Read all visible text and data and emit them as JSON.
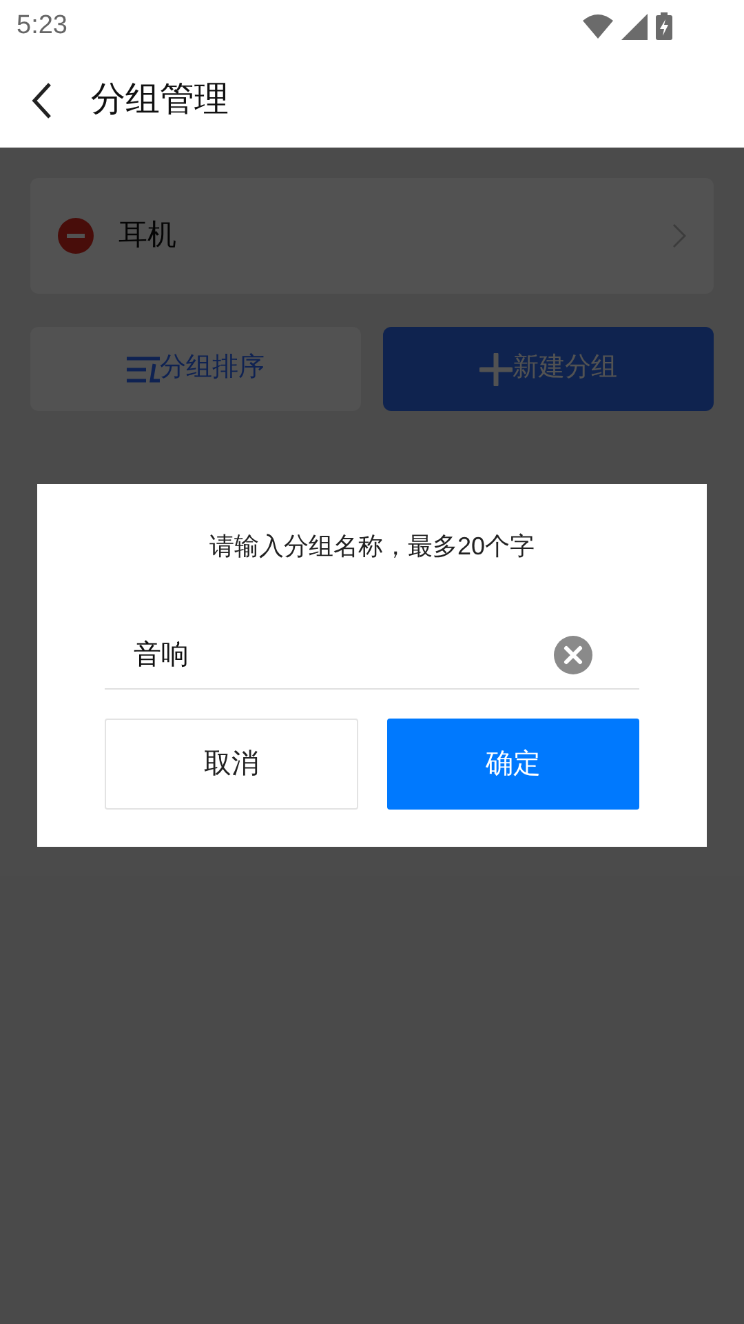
{
  "status_bar": {
    "time": "5:23"
  },
  "header": {
    "title": "分组管理"
  },
  "groups": [
    {
      "name": "耳机"
    }
  ],
  "actions": [
    {
      "kind": "sort",
      "label": "分组排序"
    },
    {
      "kind": "add",
      "label": "新建分组"
    }
  ],
  "dialog": {
    "title": "请输入分组名称，最多20个字",
    "input": {
      "value": "音响"
    },
    "buttons": [
      {
        "kind": "cancel",
        "label": "取消"
      },
      {
        "kind": "confirm",
        "label": "确定"
      }
    ]
  }
}
